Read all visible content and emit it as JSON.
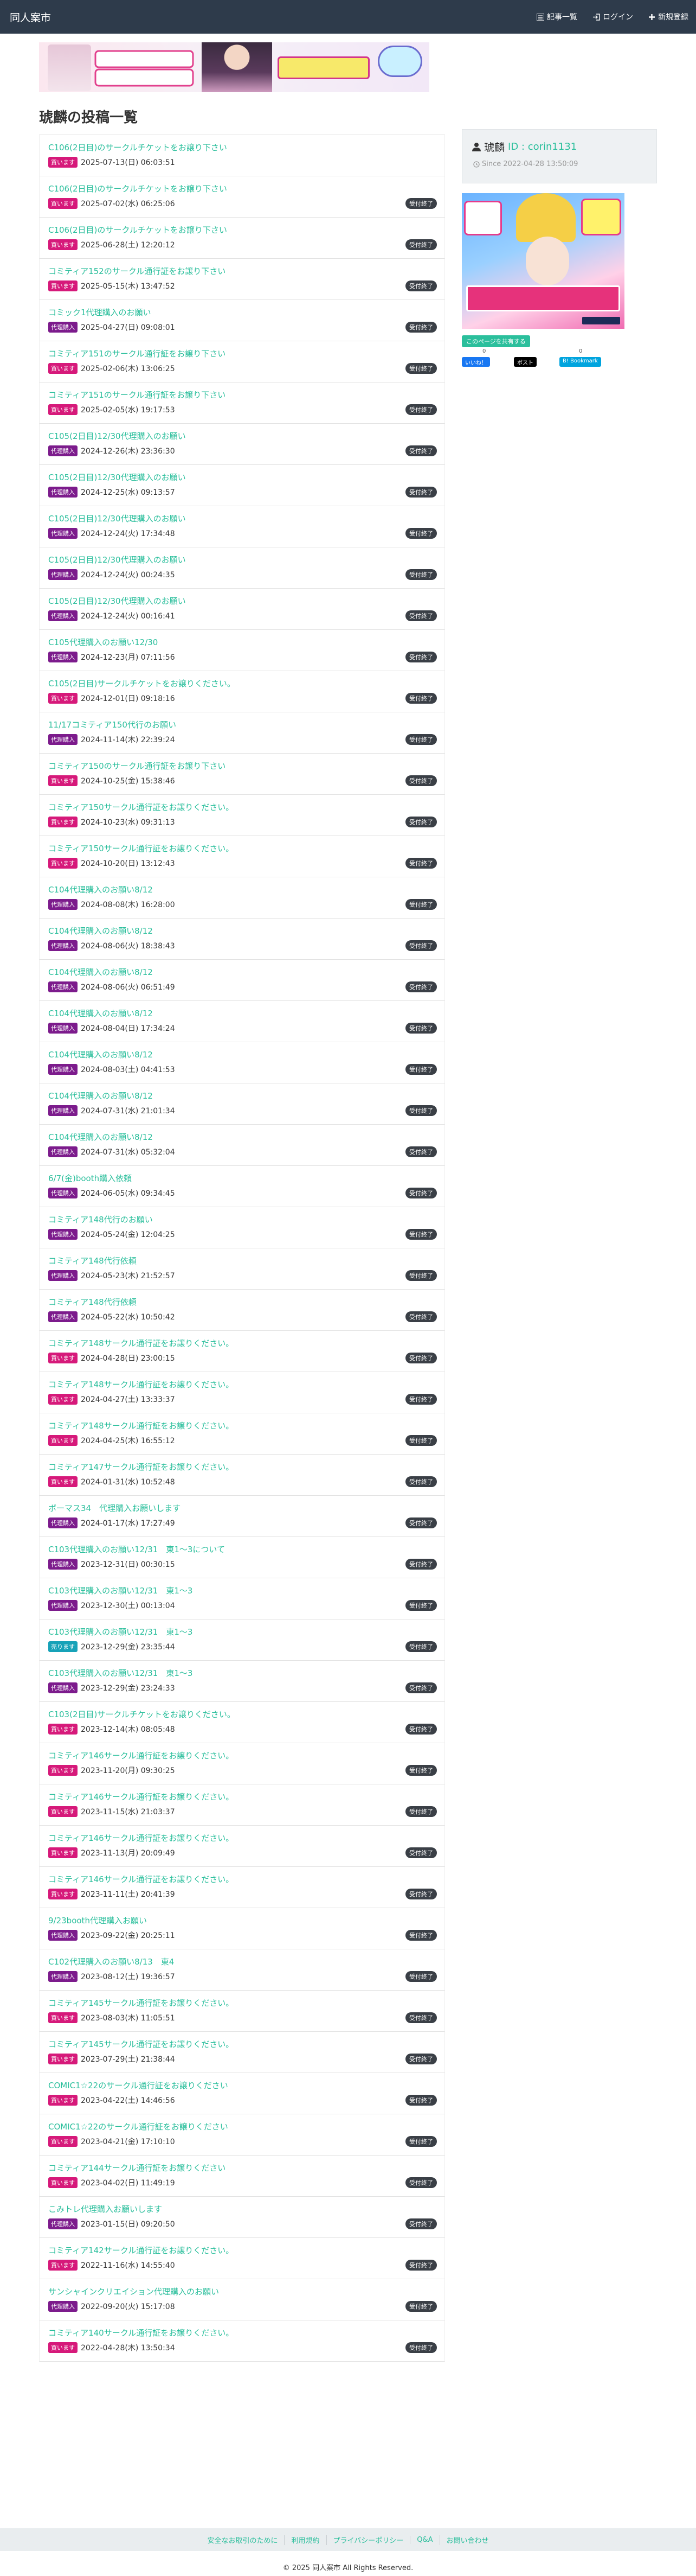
{
  "site": {
    "brand": "同人案市"
  },
  "nav": {
    "articles": "記事一覧",
    "login": "ログイン",
    "register": "新規登録"
  },
  "page_title": "琥麟の投稿一覧",
  "profile": {
    "name": "琥麟",
    "id_label": "ID : corin1131",
    "since": "Since 2022-04-28 13:50:09"
  },
  "share": {
    "header": "このページを共有する",
    "count1": "0",
    "count2": "0",
    "fb": "いいね！",
    "x": "ポスト",
    "hb": "B! Bookmark"
  },
  "posts": [
    {
      "title": "C106(2日目)のサークルチケットをお譲り下さい",
      "tag": "買います",
      "tag_type": "buy",
      "date": "2025-07-13(日) 06:03:51",
      "closed": ""
    },
    {
      "title": "C106(2日目)のサークルチケットをお譲り下さい",
      "tag": "買います",
      "tag_type": "buy",
      "date": "2025-07-02(水) 06:25:06",
      "closed": "受付終了"
    },
    {
      "title": "C106(2日目)のサークルチケットをお譲り下さい",
      "tag": "買います",
      "tag_type": "buy",
      "date": "2025-06-28(土) 12:20:12",
      "closed": "受付終了"
    },
    {
      "title": "コミティア152のサークル通行証をお譲り下さい",
      "tag": "買います",
      "tag_type": "buy",
      "date": "2025-05-15(木) 13:47:52",
      "closed": "受付終了"
    },
    {
      "title": "コミック1代理購入のお願い",
      "tag": "代理購入",
      "tag_type": "proxy",
      "date": "2025-04-27(日) 09:08:01",
      "closed": "受付終了"
    },
    {
      "title": "コミティア151のサークル通行証をお譲り下さい",
      "tag": "買います",
      "tag_type": "buy",
      "date": "2025-02-06(木) 13:06:25",
      "closed": "受付終了"
    },
    {
      "title": "コミティア151のサークル通行証をお譲り下さい",
      "tag": "買います",
      "tag_type": "buy",
      "date": "2025-02-05(水) 19:17:53",
      "closed": "受付終了"
    },
    {
      "title": "C105(2日目)12/30代理購入のお願い",
      "tag": "代理購入",
      "tag_type": "proxy",
      "date": "2024-12-26(木) 23:36:30",
      "closed": "受付終了"
    },
    {
      "title": "C105(2日目)12/30代理購入のお願い",
      "tag": "代理購入",
      "tag_type": "proxy",
      "date": "2024-12-25(水) 09:13:57",
      "closed": "受付終了"
    },
    {
      "title": "C105(2日目)12/30代理購入のお願い",
      "tag": "代理購入",
      "tag_type": "proxy",
      "date": "2024-12-24(火) 17:34:48",
      "closed": "受付終了"
    },
    {
      "title": "C105(2日目)12/30代理購入のお願い",
      "tag": "代理購入",
      "tag_type": "proxy",
      "date": "2024-12-24(火) 00:24:35",
      "closed": "受付終了"
    },
    {
      "title": "C105(2日目)12/30代理購入のお願い",
      "tag": "代理購入",
      "tag_type": "proxy",
      "date": "2024-12-24(火) 00:16:41",
      "closed": "受付終了"
    },
    {
      "title": "C105代理購入のお願い12/30",
      "tag": "代理購入",
      "tag_type": "proxy",
      "date": "2024-12-23(月) 07:11:56",
      "closed": "受付終了"
    },
    {
      "title": "C105(2日目)サークルチケットをお譲りください。",
      "tag": "買います",
      "tag_type": "buy",
      "date": "2024-12-01(日) 09:18:16",
      "closed": "受付終了"
    },
    {
      "title": "11/17コミティア150代行のお願い",
      "tag": "代理購入",
      "tag_type": "proxy",
      "date": "2024-11-14(木) 22:39:24",
      "closed": "受付終了"
    },
    {
      "title": "コミティア150のサークル通行証をお譲り下さい",
      "tag": "買います",
      "tag_type": "buy",
      "date": "2024-10-25(金) 15:38:46",
      "closed": "受付終了"
    },
    {
      "title": "コミティア150サークル通行証をお譲りください。",
      "tag": "買います",
      "tag_type": "buy",
      "date": "2024-10-23(水) 09:31:13",
      "closed": "受付終了"
    },
    {
      "title": "コミティア150サークル通行証をお譲りください。",
      "tag": "買います",
      "tag_type": "buy",
      "date": "2024-10-20(日) 13:12:43",
      "closed": "受付終了"
    },
    {
      "title": "C104代理購入のお願い8/12",
      "tag": "代理購入",
      "tag_type": "proxy",
      "date": "2024-08-08(木) 16:28:00",
      "closed": "受付終了"
    },
    {
      "title": "C104代理購入のお願い8/12",
      "tag": "代理購入",
      "tag_type": "proxy",
      "date": "2024-08-06(火) 18:38:43",
      "closed": "受付終了"
    },
    {
      "title": "C104代理購入のお願い8/12",
      "tag": "代理購入",
      "tag_type": "proxy",
      "date": "2024-08-06(火) 06:51:49",
      "closed": "受付終了"
    },
    {
      "title": "C104代理購入のお願い8/12",
      "tag": "代理購入",
      "tag_type": "proxy",
      "date": "2024-08-04(日) 17:34:24",
      "closed": "受付終了"
    },
    {
      "title": "C104代理購入のお願い8/12",
      "tag": "代理購入",
      "tag_type": "proxy",
      "date": "2024-08-03(土) 04:41:53",
      "closed": "受付終了"
    },
    {
      "title": "C104代理購入のお願い8/12",
      "tag": "代理購入",
      "tag_type": "proxy",
      "date": "2024-07-31(水) 21:01:34",
      "closed": "受付終了"
    },
    {
      "title": "C104代理購入のお願い8/12",
      "tag": "代理購入",
      "tag_type": "proxy",
      "date": "2024-07-31(水) 05:32:04",
      "closed": "受付終了"
    },
    {
      "title": "6/7(金)booth購入依頼",
      "tag": "代理購入",
      "tag_type": "proxy",
      "date": "2024-06-05(水) 09:34:45",
      "closed": "受付終了"
    },
    {
      "title": "コミティア148代行のお願い",
      "tag": "代理購入",
      "tag_type": "proxy",
      "date": "2024-05-24(金) 12:04:25",
      "closed": "受付終了"
    },
    {
      "title": "コミティア148代行依頼",
      "tag": "代理購入",
      "tag_type": "proxy",
      "date": "2024-05-23(木) 21:52:57",
      "closed": "受付終了"
    },
    {
      "title": "コミティア148代行依頼",
      "tag": "代理購入",
      "tag_type": "proxy",
      "date": "2024-05-22(水) 10:50:42",
      "closed": "受付終了"
    },
    {
      "title": "コミティア148サークル通行証をお譲りください。",
      "tag": "買います",
      "tag_type": "buy",
      "date": "2024-04-28(日) 23:00:15",
      "closed": "受付終了"
    },
    {
      "title": "コミティア148サークル通行証をお譲りください。",
      "tag": "買います",
      "tag_type": "buy",
      "date": "2024-04-27(土) 13:33:37",
      "closed": "受付終了"
    },
    {
      "title": "コミティア148サークル通行証をお譲りください。",
      "tag": "買います",
      "tag_type": "buy",
      "date": "2024-04-25(木) 16:55:12",
      "closed": "受付終了"
    },
    {
      "title": "コミティア147サークル通行証をお譲りください。",
      "tag": "買います",
      "tag_type": "buy",
      "date": "2024-01-31(水) 10:52:48",
      "closed": "受付終了"
    },
    {
      "title": "ボーマス34　代理購入お願いします",
      "tag": "代理購入",
      "tag_type": "proxy",
      "date": "2024-01-17(水) 17:27:49",
      "closed": "受付終了"
    },
    {
      "title": "C103代理購入のお願い12/31　東1〜3について",
      "tag": "代理購入",
      "tag_type": "proxy",
      "date": "2023-12-31(日) 00:30:15",
      "closed": "受付終了"
    },
    {
      "title": "C103代理購入のお願い12/31　東1〜3",
      "tag": "代理購入",
      "tag_type": "proxy",
      "date": "2023-12-30(土) 00:13:04",
      "closed": "受付終了"
    },
    {
      "title": "C103代理購入のお願い12/31　東1〜3",
      "tag": "売ります",
      "tag_type": "sell",
      "date": "2023-12-29(金) 23:35:44",
      "closed": "受付終了"
    },
    {
      "title": "C103代理購入のお願い12/31　東1〜3",
      "tag": "代理購入",
      "tag_type": "proxy",
      "date": "2023-12-29(金) 23:24:33",
      "closed": "受付終了"
    },
    {
      "title": "C103(2日目)サークルチケットをお譲りください。",
      "tag": "買います",
      "tag_type": "buy",
      "date": "2023-12-14(木) 08:05:48",
      "closed": "受付終了"
    },
    {
      "title": "コミティア146サークル通行証をお譲りください。",
      "tag": "買います",
      "tag_type": "buy",
      "date": "2023-11-20(月) 09:30:25",
      "closed": "受付終了"
    },
    {
      "title": "コミティア146サークル通行証をお譲りください。",
      "tag": "買います",
      "tag_type": "buy",
      "date": "2023-11-15(水) 21:03:37",
      "closed": "受付終了"
    },
    {
      "title": "コミティア146サークル通行証をお譲りください。",
      "tag": "買います",
      "tag_type": "buy",
      "date": "2023-11-13(月) 20:09:49",
      "closed": "受付終了"
    },
    {
      "title": "コミティア146サークル通行証をお譲りください。",
      "tag": "買います",
      "tag_type": "buy",
      "date": "2023-11-11(土) 20:41:39",
      "closed": "受付終了"
    },
    {
      "title": "9/23booth代理購入お願い",
      "tag": "代理購入",
      "tag_type": "proxy",
      "date": "2023-09-22(金) 20:25:11",
      "closed": "受付終了"
    },
    {
      "title": "C102代理購入のお願い8/13　東4",
      "tag": "代理購入",
      "tag_type": "proxy",
      "date": "2023-08-12(土) 19:36:57",
      "closed": "受付終了"
    },
    {
      "title": "コミティア145サークル通行証をお譲りください。",
      "tag": "買います",
      "tag_type": "buy",
      "date": "2023-08-03(木) 11:05:51",
      "closed": "受付終了"
    },
    {
      "title": "コミティア145サークル通行証をお譲りください。",
      "tag": "買います",
      "tag_type": "buy",
      "date": "2023-07-29(土) 21:38:44",
      "closed": "受付終了"
    },
    {
      "title": "COMIC1☆22のサークル通行証をお譲りください",
      "tag": "買います",
      "tag_type": "buy",
      "date": "2023-04-22(土) 14:46:56",
      "closed": "受付終了"
    },
    {
      "title": "COMIC1☆22のサークル通行証をお譲りください",
      "tag": "買います",
      "tag_type": "buy",
      "date": "2023-04-21(金) 17:10:10",
      "closed": "受付終了"
    },
    {
      "title": "コミティア144サークル通行証をお譲りください",
      "tag": "買います",
      "tag_type": "buy",
      "date": "2023-04-02(日) 11:49:19",
      "closed": "受付終了"
    },
    {
      "title": "こみトレ代理購入お願いします",
      "tag": "代理購入",
      "tag_type": "proxy",
      "date": "2023-01-15(日) 09:20:50",
      "closed": "受付終了"
    },
    {
      "title": "コミティア142サークル通行証をお譲りください。",
      "tag": "買います",
      "tag_type": "buy",
      "date": "2022-11-16(水) 14:55:40",
      "closed": "受付終了"
    },
    {
      "title": "サンシャインクリエイション代理購入のお願い",
      "tag": "代理購入",
      "tag_type": "proxy",
      "date": "2022-09-20(火) 15:17:08",
      "closed": "受付終了"
    },
    {
      "title": "コミティア140サークル通行証をお譲りください。",
      "tag": "買います",
      "tag_type": "buy",
      "date": "2022-04-28(木) 13:50:34",
      "closed": "受付終了"
    }
  ],
  "footer": {
    "links": [
      "安全なお取引のために",
      "利用規約",
      "プライバシーポリシー",
      "Q&A",
      "お問い合わせ"
    ],
    "copyright": "© 2025 同人案市 All Rights Reserved."
  }
}
